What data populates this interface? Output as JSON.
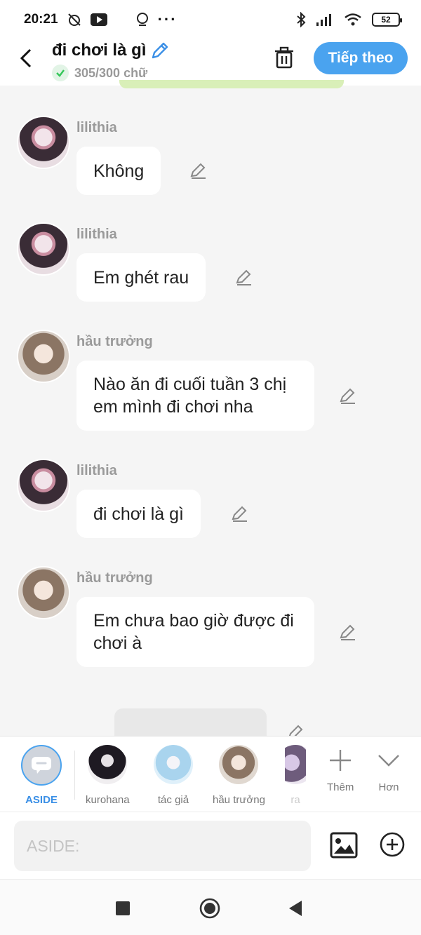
{
  "status_bar": {
    "time": "20:21",
    "battery": "52"
  },
  "header": {
    "title": "đi chơi là gì",
    "word_count": "305/300 chữ",
    "next_label": "Tiếp theo"
  },
  "messages": [
    {
      "sender": "lilithia",
      "text": "Không",
      "avatar": "lilithia-avatar"
    },
    {
      "sender": "lilithia",
      "text": "Em ghét rau",
      "avatar": "lilithia-avatar"
    },
    {
      "sender": "hầu trưởng",
      "text": "Nào ăn đi cuối tuần 3 chị em mình đi chơi nha",
      "avatar": "hau-truong-avatar"
    },
    {
      "sender": "lilithia",
      "text": "đi chơi là gì",
      "avatar": "lilithia-avatar"
    },
    {
      "sender": "hầu trưởng",
      "text": "Em chưa bao giờ được đi chơi à",
      "avatar": "hau-truong-avatar"
    }
  ],
  "characters": {
    "aside": "ASIDE",
    "items": [
      "kurohana",
      "tác giả",
      "hầu trưởng",
      "ra"
    ],
    "add_label": "Thêm",
    "more_label": "Hơn"
  },
  "input": {
    "placeholder": "ASIDE:"
  },
  "colors": {
    "accent": "#4aa3ef",
    "background": "#f5f5f5",
    "success": "#34c759"
  }
}
